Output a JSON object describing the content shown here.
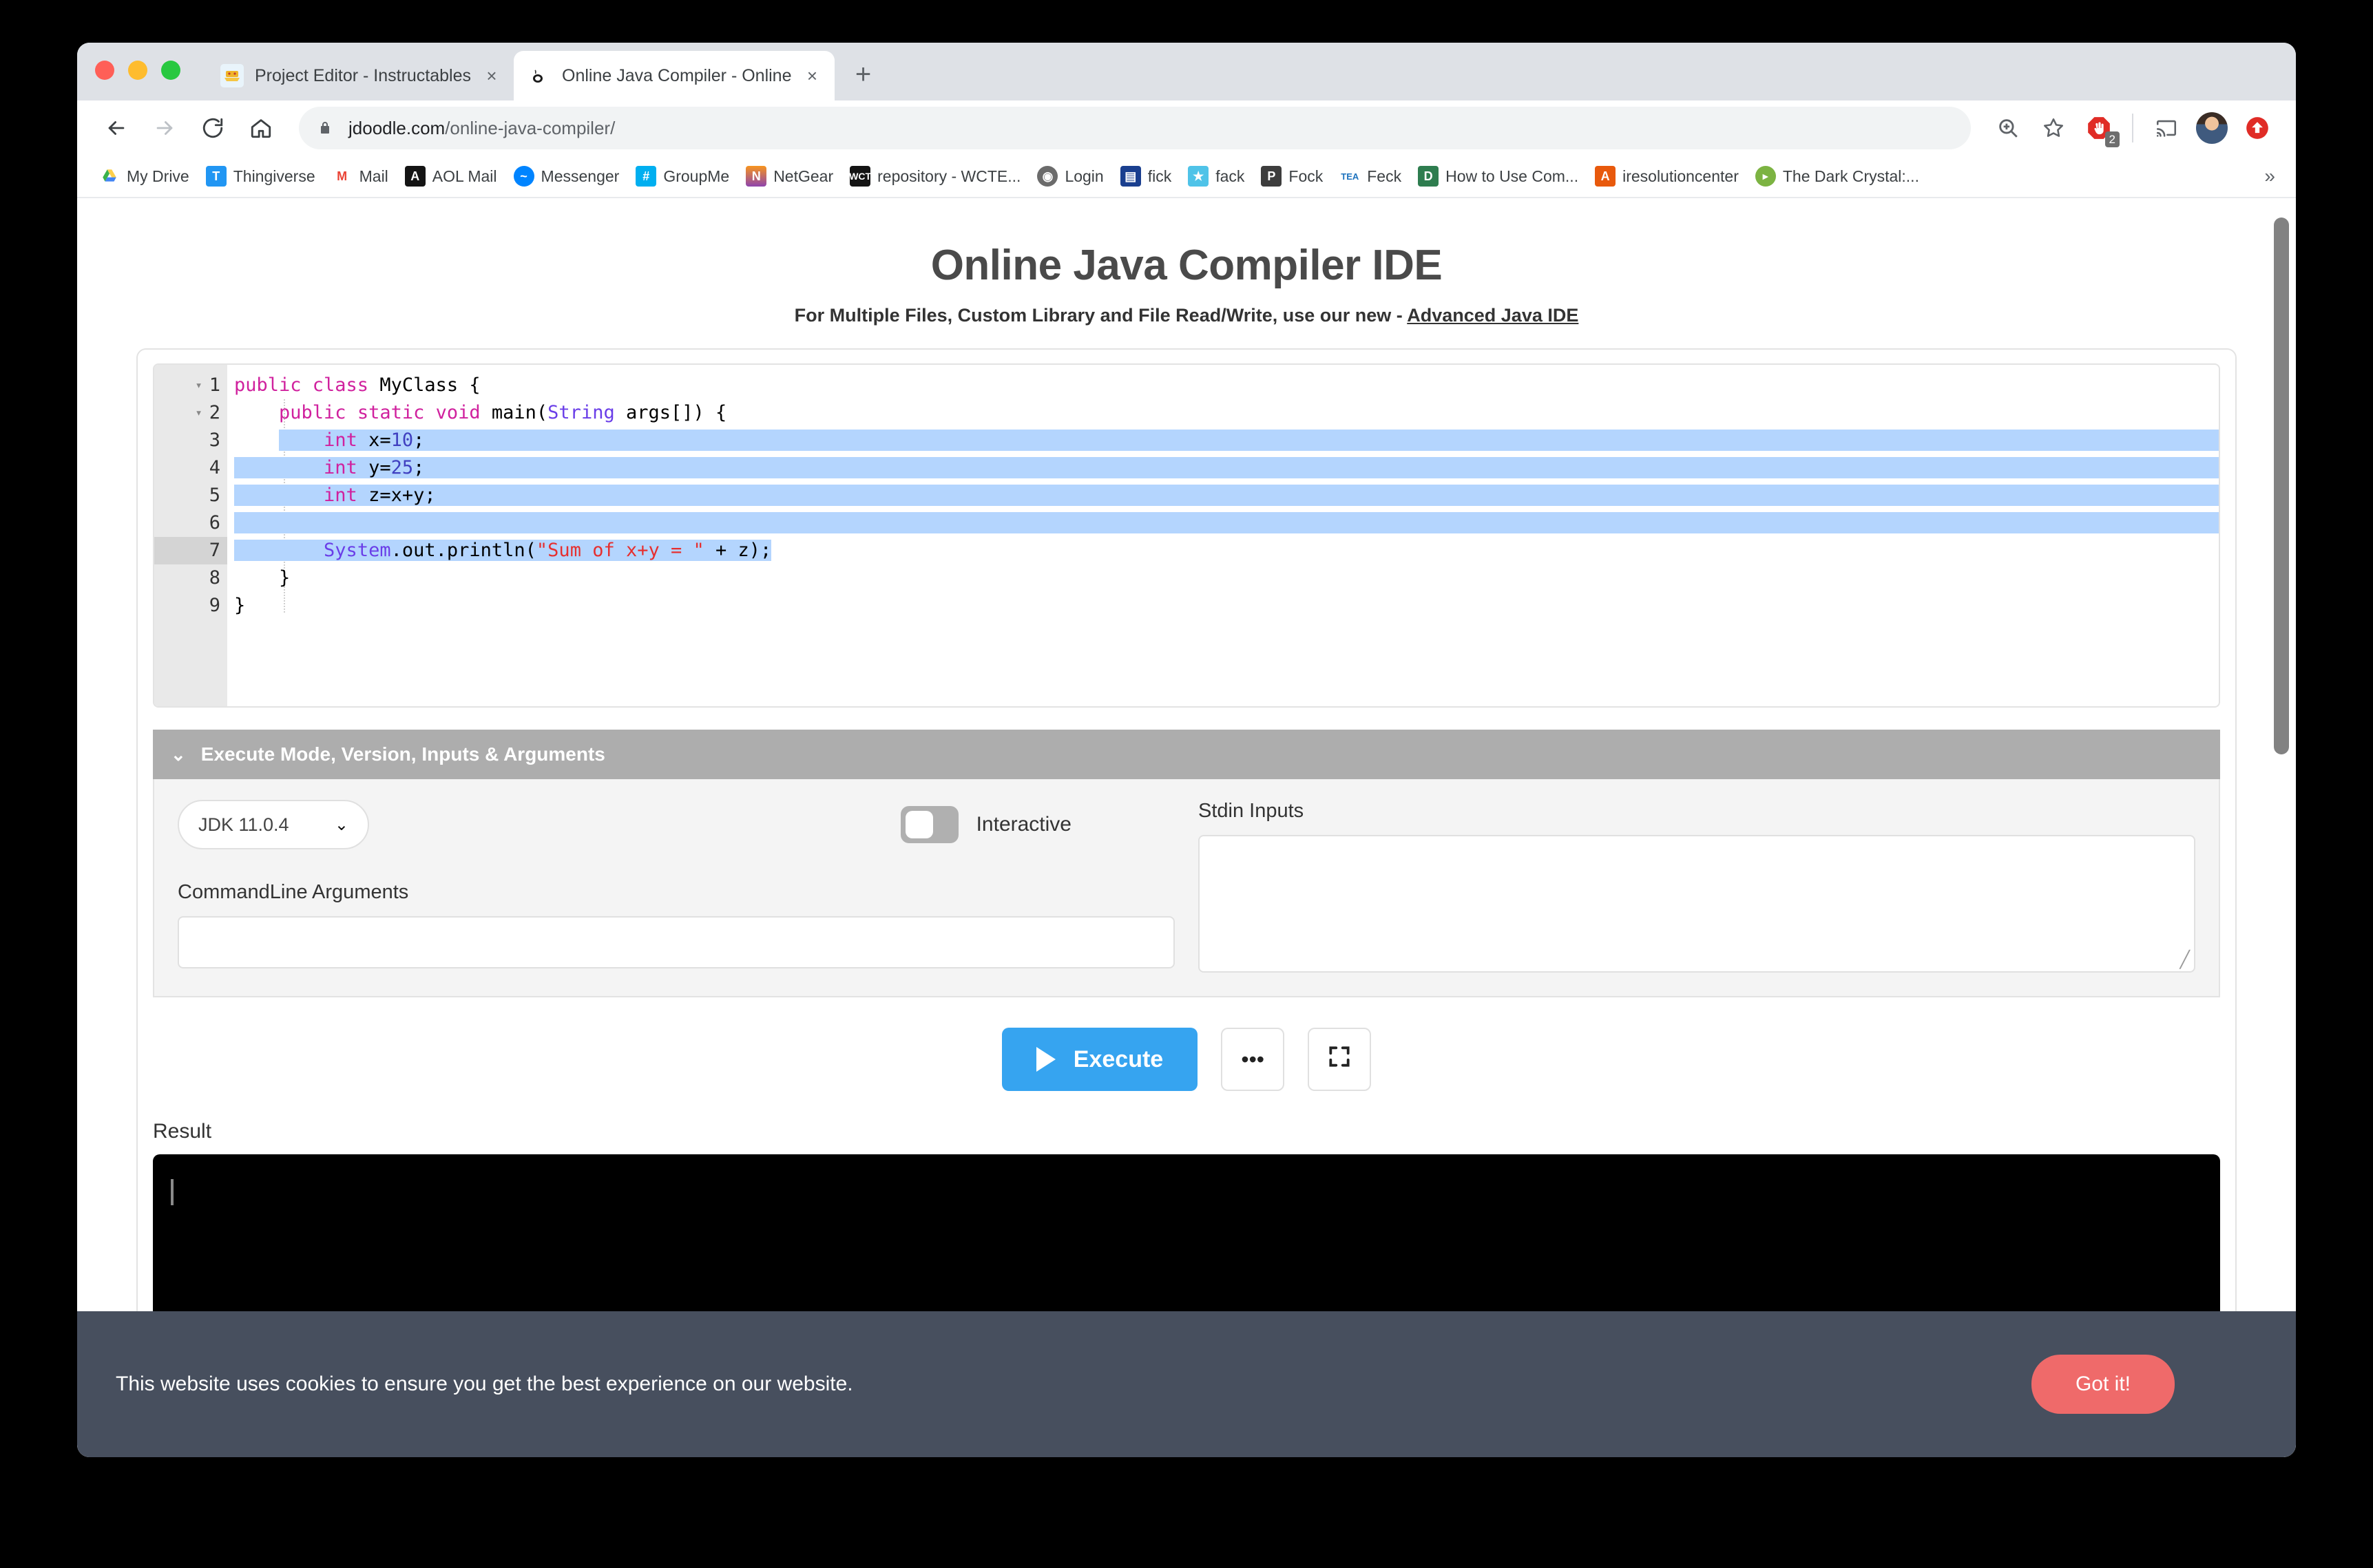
{
  "browser": {
    "traffic_lights": [
      "close",
      "minimize",
      "maximize"
    ],
    "tabs": [
      {
        "title": "Project Editor - Instructables",
        "favicon": "instructables-robot-icon",
        "active": false,
        "close_label": "×"
      },
      {
        "title": "Online Java Compiler - Online ",
        "favicon": "jdoodle-coffee-icon",
        "active": true,
        "close_label": "×"
      }
    ],
    "new_tab_label": "+",
    "toolbar": {
      "back": "←",
      "forward": "→",
      "reload": "⟳",
      "home": "⌂",
      "url_domain": "jdoodle.com",
      "url_path": "/online-java-compiler/",
      "zoom_label": "zoom-in-icon",
      "bookmark_label": "☆",
      "adblock_badge": "2",
      "cast_label": "cast-icon",
      "avatar_label": "user-avatar",
      "upload_label": "upload-icon"
    },
    "bookmarks": [
      {
        "label": "My Drive",
        "icon": "google-drive",
        "color": "#ffffff",
        "glyph": "△"
      },
      {
        "label": "Thingiverse",
        "icon": "thingiverse",
        "color": "#2196f3",
        "glyph": "T"
      },
      {
        "label": "Mail",
        "icon": "gmail",
        "color": "#ffffff",
        "glyph": "M"
      },
      {
        "label": "AOL Mail",
        "icon": "aol",
        "color": "#111111",
        "glyph": "A"
      },
      {
        "label": "Messenger",
        "icon": "messenger",
        "color": "#0084ff",
        "glyph": "~"
      },
      {
        "label": "GroupMe",
        "icon": "groupme",
        "color": "#00aff0",
        "glyph": "#"
      },
      {
        "label": "NetGear",
        "icon": "netgear",
        "color": "#f5a623",
        "glyph": "N"
      },
      {
        "label": "repository - WCTE...",
        "icon": "wct",
        "color": "#111111",
        "glyph": "W"
      },
      {
        "label": "Login",
        "icon": "globe",
        "color": "#555555",
        "glyph": "⊕"
      },
      {
        "label": "fick",
        "icon": "blue-square",
        "color": "#1a3f8f",
        "glyph": "▤"
      },
      {
        "label": "fack",
        "icon": "star-blue",
        "color": "#4fc3e8",
        "glyph": "★"
      },
      {
        "label": "Fock",
        "icon": "p-square",
        "color": "#3d3d3d",
        "glyph": "P"
      },
      {
        "label": "Feck",
        "icon": "tea",
        "color": "#ffffff",
        "glyph": "T"
      },
      {
        "label": "How to Use Com...",
        "icon": "doc-green",
        "color": "#2e7d4f",
        "glyph": "D"
      },
      {
        "label": "iresolutioncenter",
        "icon": "adobe-a",
        "color": "#e8590c",
        "glyph": "A"
      },
      {
        "label": "The Dark Crystal:...",
        "icon": "play-green",
        "color": "#7cb342",
        "glyph": "▶"
      }
    ],
    "bookmarks_overflow": "»"
  },
  "page": {
    "title": "Online Java Compiler IDE",
    "subtitle_prefix": "For Multiple Files, Custom Library and File Read/Write, use our new - ",
    "subtitle_link": "Advanced Java IDE",
    "editor": {
      "lines": [
        {
          "num": "1",
          "foldable": true,
          "selected": false
        },
        {
          "num": "2",
          "foldable": true,
          "selected": false
        },
        {
          "num": "3",
          "foldable": false,
          "selected": true
        },
        {
          "num": "4",
          "foldable": false,
          "selected": true
        },
        {
          "num": "5",
          "foldable": false,
          "selected": true
        },
        {
          "num": "6",
          "foldable": false,
          "selected": true
        },
        {
          "num": "7",
          "foldable": false,
          "selected": true,
          "active": true
        },
        {
          "num": "8",
          "foldable": false,
          "selected": false
        },
        {
          "num": "9",
          "foldable": false,
          "selected": false
        }
      ],
      "code_text": [
        "public class MyClass {",
        "    public static void main(String args[]) {",
        "        int x=10;",
        "        int y=25;",
        "        int z=x+y;",
        "",
        "        System.out.println(\"Sum of x+y = \" + z);",
        "    }",
        "}"
      ],
      "active_line": "7"
    },
    "accordion": {
      "chevron": "⌄",
      "title": "Execute Mode, Version, Inputs & Arguments"
    },
    "controls": {
      "jdk_version": "JDK 11.0.4",
      "jdk_caret": "⌄",
      "interactive_label": "Interactive",
      "interactive_on": false,
      "commandline_label": "CommandLine Arguments",
      "commandline_value": "",
      "stdin_label": "Stdin Inputs",
      "stdin_value": "",
      "resize_grip": "╱"
    },
    "actions": {
      "execute_label": "Execute",
      "more_label": "•••",
      "fullscreen_label": "fullscreen-icon"
    },
    "result": {
      "label": "Result",
      "output": ""
    },
    "cookie": {
      "message": "This website uses cookies to ensure you get the best experience on our website.",
      "button": "Got it!"
    }
  },
  "colors": {
    "accent_blue": "#36a4f0",
    "cookie_bg": "#474f5e",
    "cookie_btn": "#ef6a6a",
    "accordion_bg": "#adadad",
    "selection": "#b4d5fe"
  }
}
